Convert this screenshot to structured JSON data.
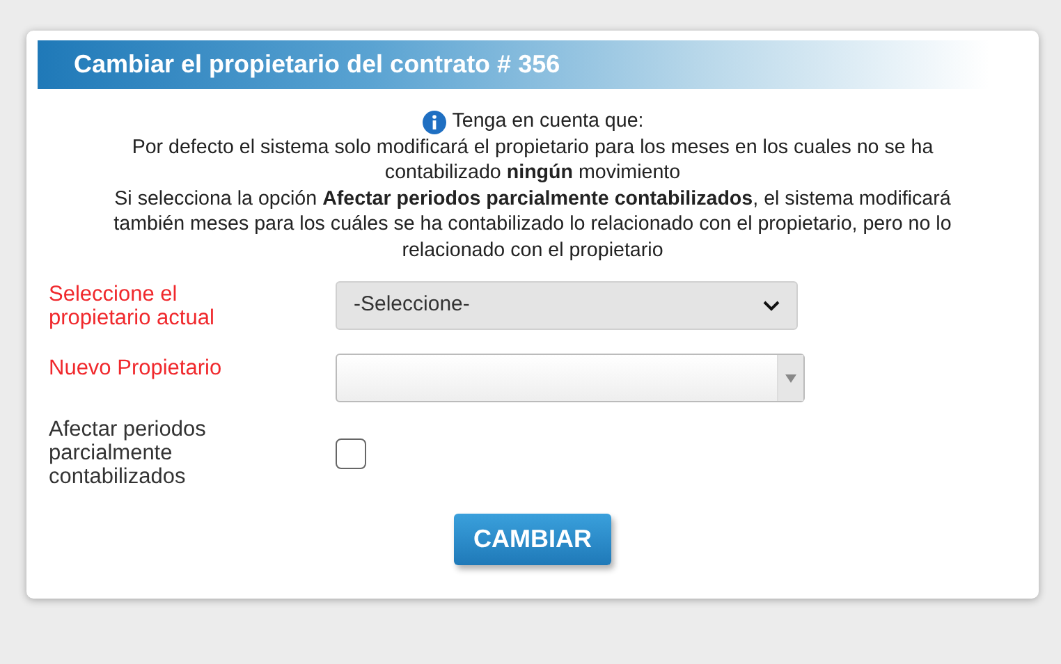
{
  "dialog": {
    "title": "Cambiar el propietario del contrato # 356",
    "notice": {
      "heading": "Tenga en cuenta que:",
      "paragraphs": [
        "Por defecto el sistema solo modificará el propietario para los meses en los cuales no se ha contabilizado **ningún** movimiento",
        "Si selecciona la opción **Afectar periodos parcialmente contabilizados**, el sistema modificará también meses para los cuáles se ha contabilizado lo relacionado con el propietario, pero no lo relacionado con el propietario"
      ]
    },
    "fields": [
      {
        "kind": "select",
        "label": "Seleccione el propietario actual",
        "required": true,
        "value": "-Seleccione-"
      },
      {
        "kind": "combo",
        "label": "Nuevo Propietario",
        "required": true
      },
      {
        "kind": "checkbox",
        "label": "Afectar periodos parcialmente contabilizados",
        "required": false,
        "checked": false
      }
    ],
    "button": "CAMBIAR"
  }
}
